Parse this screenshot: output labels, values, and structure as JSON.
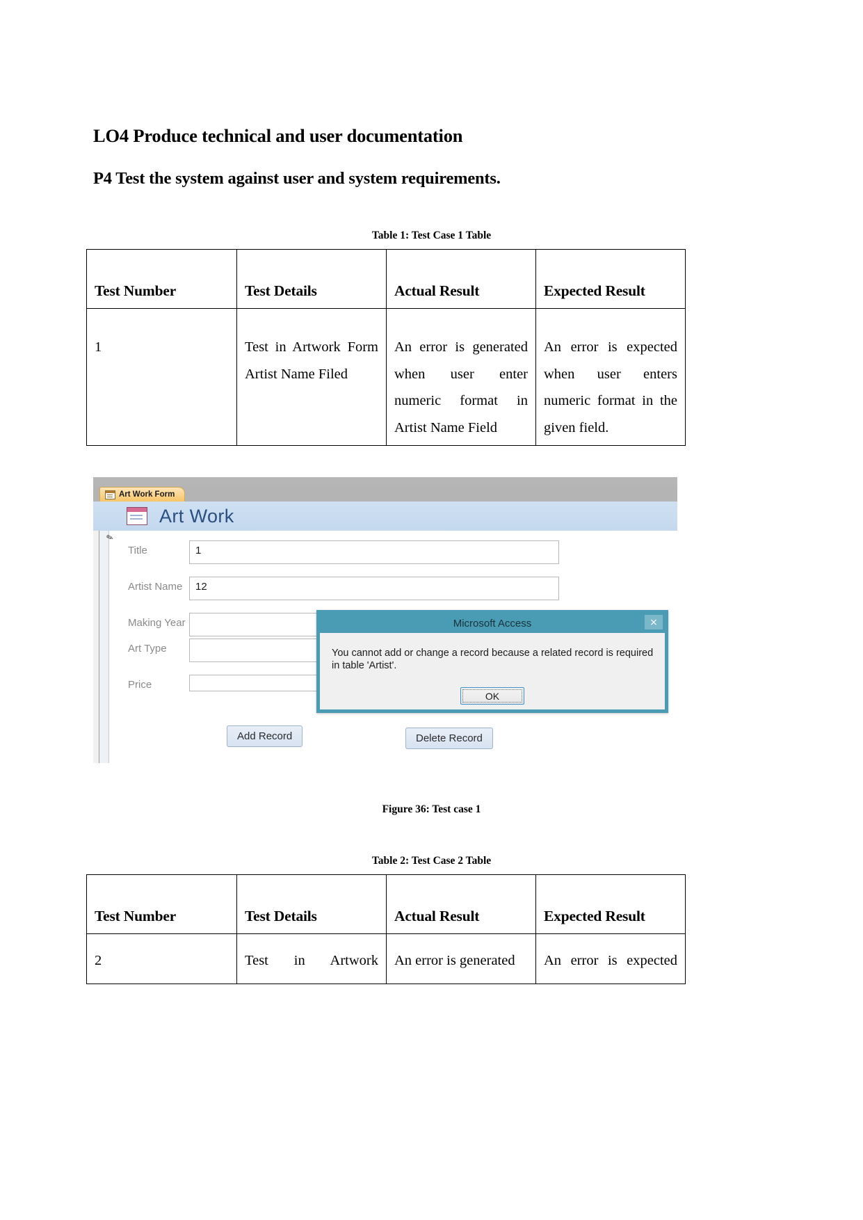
{
  "document": {
    "heading_lo4": "LO4 Produce technical and user documentation",
    "heading_p4": "P4 Test the system against user and system requirements.",
    "figure_caption": "Figure 36: Test case 1"
  },
  "table1": {
    "caption": "Table 1: Test Case 1 Table",
    "headers": [
      "Test Number",
      "Test Details",
      "Actual Result",
      "Expected Result"
    ],
    "rows": [
      {
        "test_number": "1",
        "test_details": "Test in Artwork Form Artist Name Filed",
        "actual_result": "An error is generated when user enter numeric format in Artist Name Field",
        "expected_result": "An error is expected when user enters numeric format in the given field."
      }
    ]
  },
  "table2": {
    "caption": "Table 2: Test Case 2 Table",
    "headers": [
      "Test Number",
      "Test Details",
      "Actual Result",
      "Expected Result"
    ],
    "rows": [
      {
        "test_number": "2",
        "test_details": "Test in Artwork",
        "actual_result": "An error is generated",
        "expected_result": "An error is expected"
      }
    ]
  },
  "access_screenshot": {
    "tab_label": "Art Work Form",
    "form_title": "Art Work",
    "fields": [
      {
        "label": "Title",
        "value": "1"
      },
      {
        "label": "Artist Name",
        "value": "12"
      },
      {
        "label": "Making Year",
        "value": ""
      },
      {
        "label": "Art Type",
        "value": ""
      },
      {
        "label": "Price",
        "value": ""
      }
    ],
    "buttons": {
      "add_record": "Add Record",
      "delete_record": "Delete Record"
    },
    "dialog": {
      "title": "Microsoft Access",
      "message": "You cannot add or change a record because a related record is required in table 'Artist'.",
      "ok_label": "OK",
      "close_glyph": "×",
      "titlebar_color": "#4a9cb4"
    }
  }
}
